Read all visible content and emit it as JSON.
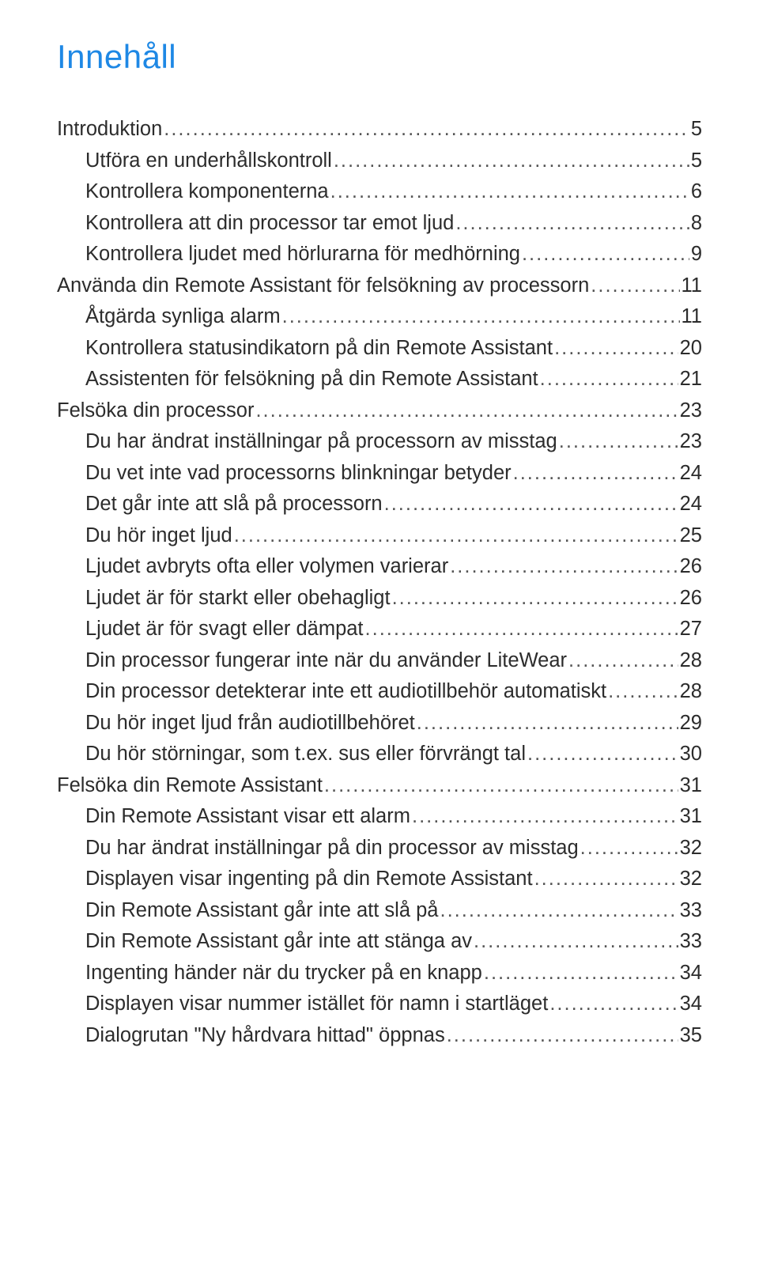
{
  "title": "Innehåll",
  "toc": [
    {
      "label": "Introduktion",
      "page": "5",
      "indent": 0
    },
    {
      "label": "Utföra en underhållskontroll",
      "page": "5",
      "indent": 1
    },
    {
      "label": "Kontrollera komponenterna",
      "page": "6",
      "indent": 1
    },
    {
      "label": "Kontrollera att din processor tar emot ljud",
      "page": "8",
      "indent": 1
    },
    {
      "label": "Kontrollera ljudet med hörlurarna för medhörning",
      "page": "9",
      "indent": 1
    },
    {
      "label": "Använda din Remote Assistant för felsökning av processorn",
      "page": "11",
      "indent": 0
    },
    {
      "label": "Åtgärda synliga alarm",
      "page": "11",
      "indent": 1
    },
    {
      "label": "Kontrollera statusindikatorn på din Remote Assistant",
      "page": "20",
      "indent": 1
    },
    {
      "label": "Assistenten för felsökning på din Remote Assistant",
      "page": "21",
      "indent": 1
    },
    {
      "label": "Felsöka din processor",
      "page": "23",
      "indent": 0
    },
    {
      "label": "Du har ändrat inställningar på processorn av misstag",
      "page": "23",
      "indent": 1
    },
    {
      "label": "Du vet inte vad processorns blinkningar betyder",
      "page": "24",
      "indent": 1
    },
    {
      "label": "Det går inte att slå på processorn",
      "page": "24",
      "indent": 1
    },
    {
      "label": "Du hör inget ljud",
      "page": "25",
      "indent": 1
    },
    {
      "label": "Ljudet avbryts ofta eller volymen varierar",
      "page": "26",
      "indent": 1
    },
    {
      "label": "Ljudet är för starkt eller obehagligt",
      "page": "26",
      "indent": 1
    },
    {
      "label": "Ljudet är för svagt eller dämpat",
      "page": "27",
      "indent": 1
    },
    {
      "label": "Din processor fungerar inte när du använder LiteWear",
      "page": "28",
      "indent": 1
    },
    {
      "label": "Din processor detekterar inte ett audiotillbehör automatiskt",
      "page": "28",
      "indent": 1
    },
    {
      "label": "Du hör inget ljud från audiotillbehöret",
      "page": "29",
      "indent": 1
    },
    {
      "label": "Du hör störningar, som t.ex. sus eller förvrängt tal",
      "page": "30",
      "indent": 1
    },
    {
      "label": "Felsöka din Remote Assistant",
      "page": "31",
      "indent": 0
    },
    {
      "label": "Din Remote Assistant visar ett alarm",
      "page": "31",
      "indent": 1
    },
    {
      "label": "Du har ändrat inställningar på din processor av misstag",
      "page": "32",
      "indent": 1
    },
    {
      "label": "Displayen visar ingenting på din Remote Assistant",
      "page": "32",
      "indent": 1
    },
    {
      "label": "Din Remote Assistant går inte att slå på",
      "page": "33",
      "indent": 1
    },
    {
      "label": "Din Remote Assistant går inte att stänga av",
      "page": "33",
      "indent": 1
    },
    {
      "label": "Ingenting händer när du trycker på en knapp",
      "page": "34",
      "indent": 1
    },
    {
      "label": "Displayen visar nummer istället för namn i startläget",
      "page": "34",
      "indent": 1
    },
    {
      "label": "Dialogrutan \"Ny hårdvara hittad\" öppnas",
      "page": "35",
      "indent": 1
    }
  ]
}
